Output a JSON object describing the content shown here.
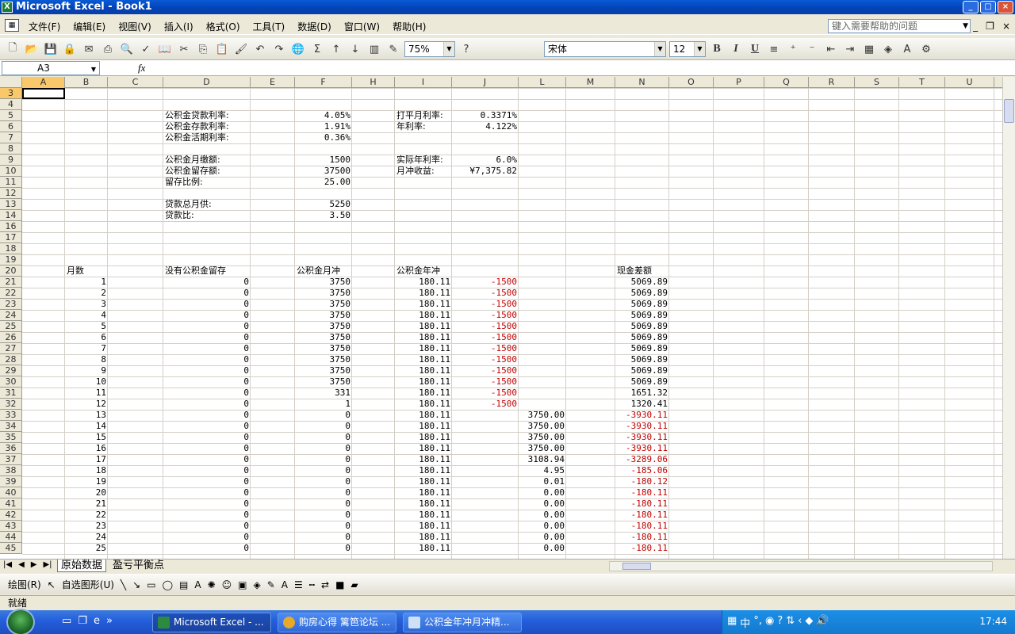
{
  "window": {
    "title": "Microsoft Excel - Book1",
    "min": "_",
    "max": "□",
    "close": "×"
  },
  "menu": {
    "items": [
      "文件(F)",
      "编辑(E)",
      "视图(V)",
      "插入(I)",
      "格式(O)",
      "工具(T)",
      "数据(D)",
      "窗口(W)",
      "帮助(H)"
    ],
    "help_placeholder": "键入需要帮助的问题",
    "doc_min": "_",
    "doc_restore": "❐",
    "doc_close": "×"
  },
  "toolbar": {
    "zoom": "75%",
    "font": "宋体",
    "size": "12",
    "bold": "B",
    "italic": "I",
    "underline": "U"
  },
  "formula": {
    "name_box": "A3",
    "fx": "fx"
  },
  "columns": [
    "A",
    "B",
    "C",
    "D",
    "E",
    "F",
    "H",
    "I",
    "J",
    "L",
    "M",
    "N",
    "O",
    "P",
    "Q",
    "R",
    "S",
    "T",
    "U"
  ],
  "rows": [
    "3",
    "4",
    "5",
    "6",
    "7",
    "8",
    "9",
    "10",
    "11",
    "12",
    "13",
    "14",
    "16",
    "17",
    "18",
    "19",
    "20",
    "21",
    "22",
    "23",
    "24",
    "25",
    "26",
    "27",
    "28",
    "29",
    "30",
    "31",
    "32",
    "33",
    "34",
    "35",
    "36",
    "37",
    "38",
    "39",
    "40",
    "41",
    "42",
    "43",
    "44",
    "45"
  ],
  "params": {
    "d5": "公积金贷款利率:",
    "f5": "4.05%",
    "i5": "打平月利率:",
    "j5": "0.3371%",
    "d6": "公积金存款利率:",
    "f6": "1.91%",
    "i6": "年利率:",
    "j6": "4.122%",
    "d7": "公积金活期利率:",
    "f7": "0.36%",
    "d9": "公积金月缴额:",
    "f9": "1500",
    "i9": "实际年利率:",
    "j9": "6.0%",
    "d10": "公积金留存额:",
    "f10": "37500",
    "i10": "月冲收益:",
    "j10": "¥7,375.82",
    "d11": "留存比例:",
    "f11": "25.00",
    "d13": "贷款总月供:",
    "f13": "5250",
    "d14": "贷款比:",
    "f14": "3.50"
  },
  "table_headers": {
    "b": "月数",
    "d": "没有公积金留存",
    "f": "公积金月冲",
    "i": "公积金年冲",
    "n": "现金差额"
  },
  "table_rows": [
    {
      "b": "1",
      "d": "0",
      "f": "3750",
      "i": "180.11",
      "j": "-1500",
      "l": "",
      "n": "5069.89"
    },
    {
      "b": "2",
      "d": "0",
      "f": "3750",
      "i": "180.11",
      "j": "-1500",
      "l": "",
      "n": "5069.89"
    },
    {
      "b": "3",
      "d": "0",
      "f": "3750",
      "i": "180.11",
      "j": "-1500",
      "l": "",
      "n": "5069.89"
    },
    {
      "b": "4",
      "d": "0",
      "f": "3750",
      "i": "180.11",
      "j": "-1500",
      "l": "",
      "n": "5069.89"
    },
    {
      "b": "5",
      "d": "0",
      "f": "3750",
      "i": "180.11",
      "j": "-1500",
      "l": "",
      "n": "5069.89"
    },
    {
      "b": "6",
      "d": "0",
      "f": "3750",
      "i": "180.11",
      "j": "-1500",
      "l": "",
      "n": "5069.89"
    },
    {
      "b": "7",
      "d": "0",
      "f": "3750",
      "i": "180.11",
      "j": "-1500",
      "l": "",
      "n": "5069.89"
    },
    {
      "b": "8",
      "d": "0",
      "f": "3750",
      "i": "180.11",
      "j": "-1500",
      "l": "",
      "n": "5069.89"
    },
    {
      "b": "9",
      "d": "0",
      "f": "3750",
      "i": "180.11",
      "j": "-1500",
      "l": "",
      "n": "5069.89"
    },
    {
      "b": "10",
      "d": "0",
      "f": "3750",
      "i": "180.11",
      "j": "-1500",
      "l": "",
      "n": "5069.89"
    },
    {
      "b": "11",
      "d": "0",
      "f": "331",
      "i": "180.11",
      "j": "-1500",
      "l": "",
      "n": "1651.32"
    },
    {
      "b": "12",
      "d": "0",
      "f": "1",
      "i": "180.11",
      "j": "-1500",
      "l": "",
      "n": "1320.41"
    },
    {
      "b": "13",
      "d": "0",
      "f": "0",
      "i": "180.11",
      "j": "",
      "l": "3750.00",
      "n": "-3930.11"
    },
    {
      "b": "14",
      "d": "0",
      "f": "0",
      "i": "180.11",
      "j": "",
      "l": "3750.00",
      "n": "-3930.11"
    },
    {
      "b": "15",
      "d": "0",
      "f": "0",
      "i": "180.11",
      "j": "",
      "l": "3750.00",
      "n": "-3930.11"
    },
    {
      "b": "16",
      "d": "0",
      "f": "0",
      "i": "180.11",
      "j": "",
      "l": "3750.00",
      "n": "-3930.11"
    },
    {
      "b": "17",
      "d": "0",
      "f": "0",
      "i": "180.11",
      "j": "",
      "l": "3108.94",
      "n": "-3289.06"
    },
    {
      "b": "18",
      "d": "0",
      "f": "0",
      "i": "180.11",
      "j": "",
      "l": "4.95",
      "n": "-185.06"
    },
    {
      "b": "19",
      "d": "0",
      "f": "0",
      "i": "180.11",
      "j": "",
      "l": "0.01",
      "n": "-180.12"
    },
    {
      "b": "20",
      "d": "0",
      "f": "0",
      "i": "180.11",
      "j": "",
      "l": "0.00",
      "n": "-180.11"
    },
    {
      "b": "21",
      "d": "0",
      "f": "0",
      "i": "180.11",
      "j": "",
      "l": "0.00",
      "n": "-180.11"
    },
    {
      "b": "22",
      "d": "0",
      "f": "0",
      "i": "180.11",
      "j": "",
      "l": "0.00",
      "n": "-180.11"
    },
    {
      "b": "23",
      "d": "0",
      "f": "0",
      "i": "180.11",
      "j": "",
      "l": "0.00",
      "n": "-180.11"
    },
    {
      "b": "24",
      "d": "0",
      "f": "0",
      "i": "180.11",
      "j": "",
      "l": "0.00",
      "n": "-180.11"
    },
    {
      "b": "25",
      "d": "0",
      "f": "0",
      "i": "180.11",
      "j": "",
      "l": "0.00",
      "n": "-180.11"
    }
  ],
  "tabs": [
    "原始数据",
    "盈亏平衡点"
  ],
  "drawbar": {
    "draw": "绘图(R)",
    "autoshapes": "自选图形(U)"
  },
  "status": "就绪",
  "taskbar": {
    "tasks": [
      "Microsoft Excel - ...",
      "购房心得 篱笆论坛 ...",
      "公积金年冲月冲精..."
    ],
    "tray_ime": "中",
    "clock": "17:44"
  },
  "colors": {
    "negative": "#c00000",
    "selected_header": "#f9c86b",
    "title_blue": "#0143b8"
  }
}
